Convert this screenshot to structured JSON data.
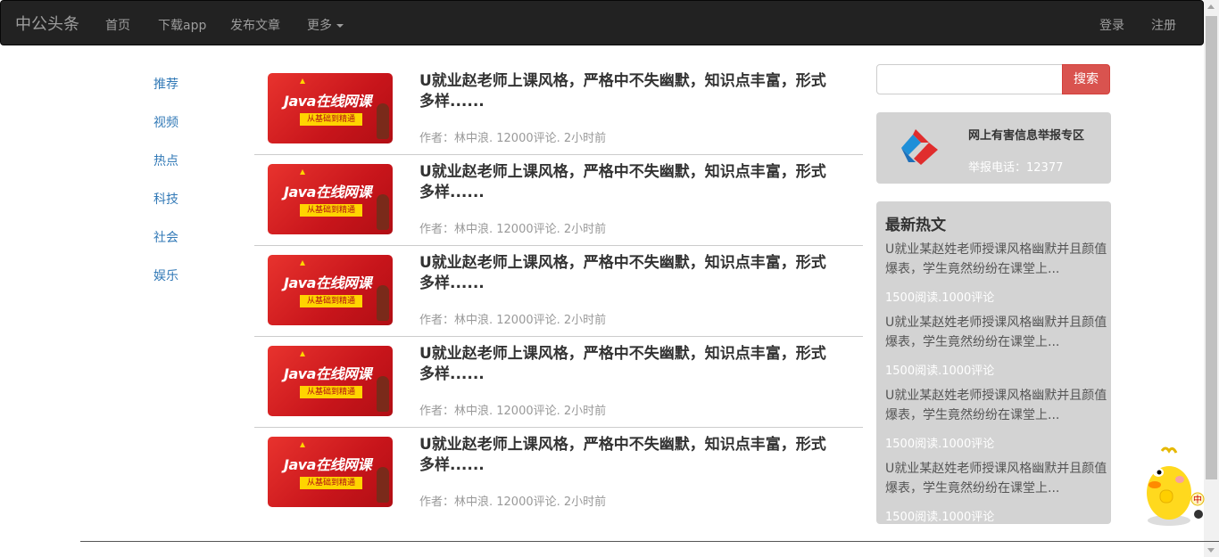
{
  "navbar": {
    "brand": "中公头条",
    "links": [
      "首页",
      "下载app",
      "发布文章",
      "更多"
    ],
    "right_links": [
      "登录",
      "注册"
    ]
  },
  "sidebar": {
    "items": [
      "推荐",
      "视频",
      "热点",
      "科技",
      "社会",
      "娱乐"
    ]
  },
  "articles": [
    {
      "title": "U就业赵老师上课风格，严格中不失幽默，知识点丰富，形式多样......",
      "meta": "作者：林中浪. 12000评论. 2小时前",
      "thumb_title": "Java在线网课",
      "thumb_sub": "从基础到精通"
    },
    {
      "title": "U就业赵老师上课风格，严格中不失幽默，知识点丰富，形式多样......",
      "meta": "作者：林中浪. 12000评论. 2小时前",
      "thumb_title": "Java在线网课",
      "thumb_sub": "从基础到精通"
    },
    {
      "title": "U就业赵老师上课风格，严格中不失幽默，知识点丰富，形式多样......",
      "meta": "作者：林中浪. 12000评论. 2小时前",
      "thumb_title": "Java在线网课",
      "thumb_sub": "从基础到精通"
    },
    {
      "title": "U就业赵老师上课风格，严格中不失幽默，知识点丰富，形式多样......",
      "meta": "作者：林中浪. 12000评论. 2小时前",
      "thumb_title": "Java在线网课",
      "thumb_sub": "从基础到精通"
    },
    {
      "title": "U就业赵老师上课风格，严格中不失幽默，知识点丰富，形式多样......",
      "meta": "作者：林中浪. 12000评论. 2小时前",
      "thumb_title": "Java在线网课",
      "thumb_sub": "从基础到精通"
    }
  ],
  "search": {
    "placeholder": "",
    "button_label": "搜索"
  },
  "report": {
    "title": "网上有害信息举报专区",
    "phone": "举报电话：12377"
  },
  "hot": {
    "heading": "最新热文",
    "items": [
      {
        "title": "U就业某赵姓老师授课风格幽默并且颜值爆表，学生竟然纷纷在课堂上...",
        "meta": "1500阅读.1000评论"
      },
      {
        "title": "U就业某赵姓老师授课风格幽默并且颜值爆表，学生竟然纷纷在课堂上...",
        "meta": "1500阅读.1000评论"
      },
      {
        "title": "U就业某赵姓老师授课风格幽默并且颜值爆表，学生竟然纷纷在课堂上...",
        "meta": "1500阅读.1000评论"
      },
      {
        "title": "U就业某赵姓老师授课风格幽默并且颜值爆表，学生竟然纷纷在课堂上...",
        "meta": "1500阅读.1000评论"
      }
    ]
  },
  "mascot": {
    "badge": "中"
  },
  "colors": {
    "navbar_bg": "#222222",
    "link": "#337ab7",
    "search_button": "#d9534f",
    "panel_bg": "#d3d3d3"
  }
}
